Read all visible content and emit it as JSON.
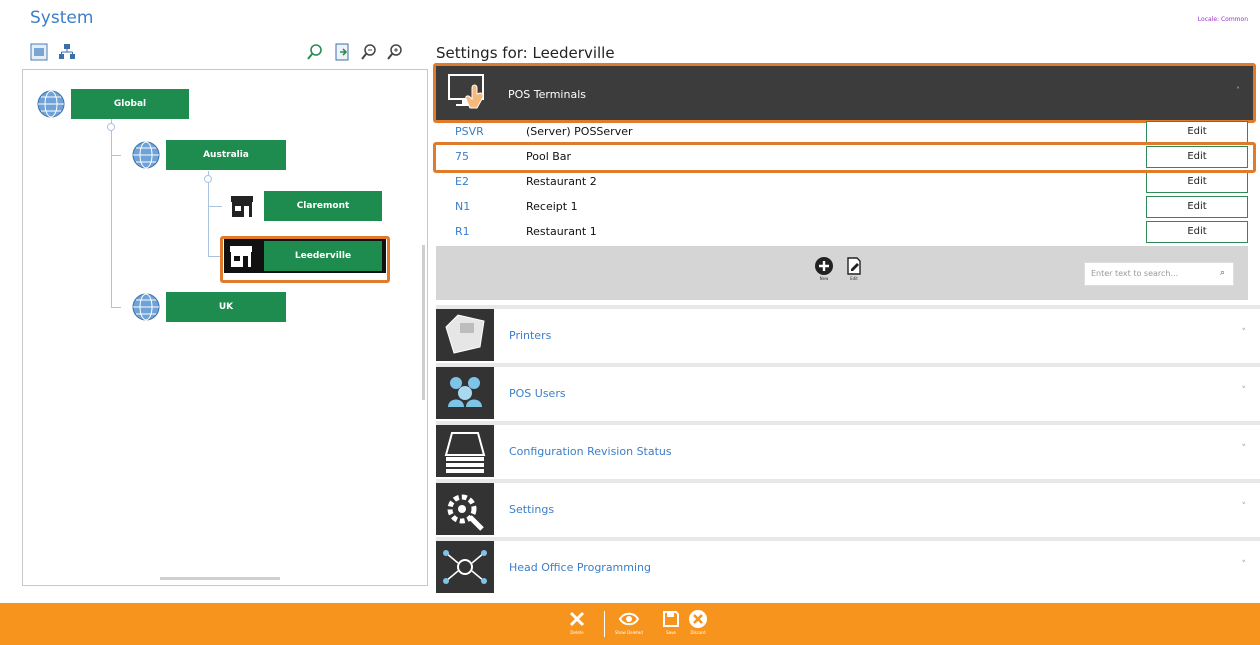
{
  "header": {
    "title": "System",
    "locale": "Locale: Common"
  },
  "tree": {
    "nodes": {
      "global": "Global",
      "australia": "Australia",
      "claremont": "Claremont",
      "leederville": "Leederville",
      "uk": "UK"
    },
    "selected": "Leederville"
  },
  "settings": {
    "title": "Settings for: Leederville",
    "expanded_section": "POS Terminals",
    "terminals": [
      {
        "code": "PSVR",
        "name": "(Server) POSServer",
        "action": "Edit"
      },
      {
        "code": "75",
        "name": "Pool Bar",
        "action": "Edit"
      },
      {
        "code": "E2",
        "name": "Restaurant 2",
        "action": "Edit"
      },
      {
        "code": "N1",
        "name": "Receipt 1",
        "action": "Edit"
      },
      {
        "code": "R1",
        "name": "Restaurant 1",
        "action": "Edit"
      }
    ],
    "highlighted_terminal": "Pool Bar",
    "toolbar": {
      "new_label": "New",
      "edit_label": "Edit"
    },
    "search_placeholder": "Enter text to search...",
    "sections": [
      {
        "label": "Printers",
        "icon": "printer-icon"
      },
      {
        "label": "POS Users",
        "icon": "users-icon"
      },
      {
        "label": "Configuration Revision Status",
        "icon": "stack-icon"
      },
      {
        "label": "Settings",
        "icon": "gears-icon"
      },
      {
        "label": "Head Office Programming",
        "icon": "network-icon"
      }
    ]
  },
  "footer": {
    "delete": "Delete",
    "show_deleted": "Show Deleted",
    "save": "Save",
    "discard": "Discard"
  },
  "colors": {
    "accent": "#f7941d",
    "node_green": "#1e8c4f",
    "highlight": "#e07b2b",
    "link_blue": "#3b7ec9"
  }
}
